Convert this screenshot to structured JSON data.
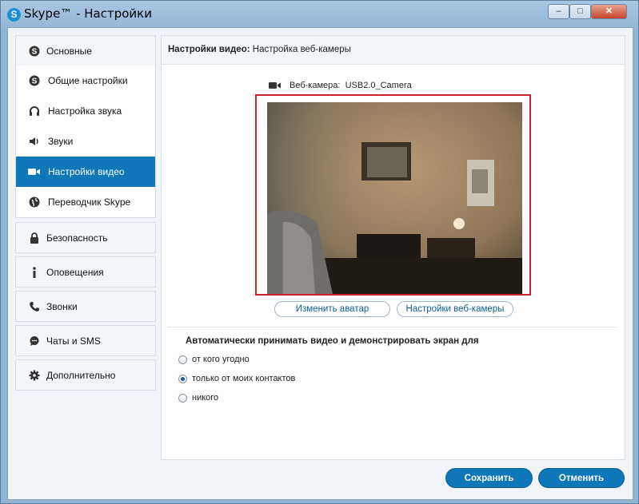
{
  "window": {
    "title": "Skype™ - Настройки",
    "title_icon": "skype-logo-icon",
    "controls": [
      "minimize-icon",
      "maximize-icon",
      "close-icon"
    ]
  },
  "sidebar": {
    "groups": [
      {
        "label": "Основные",
        "icon": "skype-icon",
        "items": [
          {
            "label": "Общие настройки",
            "icon": "skype-icon"
          },
          {
            "label": "Настройка звука",
            "icon": "headset-icon"
          },
          {
            "label": "Звуки",
            "icon": "speaker-icon"
          },
          {
            "label": "Настройки видео",
            "icon": "video-camera-icon",
            "active": true
          },
          {
            "label": "Переводчик Skype",
            "icon": "globe-icon"
          }
        ]
      },
      {
        "label": "Безопасность",
        "icon": "lock-icon"
      },
      {
        "label": "Оповещения",
        "icon": "info-icon"
      },
      {
        "label": "Звонки",
        "icon": "phone-icon"
      },
      {
        "label": "Чаты и SMS",
        "icon": "chat-icon"
      },
      {
        "label": "Дополнительно",
        "icon": "gear-icon"
      }
    ]
  },
  "main": {
    "header_bold": "Настройки видео:",
    "header_rest": " Настройка веб-камеры",
    "camera_label": "Веб-камера:",
    "camera_name": "USB2.0_Camera",
    "change_avatar": "Изменить аватар",
    "webcam_settings": "Настройки веб-камеры",
    "auto_accept_title": "Автоматически принимать видео и демонстрировать экран для",
    "radio_options": [
      {
        "label": "от кого угодно",
        "checked": false
      },
      {
        "label": "только от моих контактов",
        "checked": true
      },
      {
        "label": "никого",
        "checked": false
      }
    ]
  },
  "footer": {
    "save": "Сохранить",
    "cancel": "Отменить"
  },
  "colors": {
    "accent": "#0d77b8",
    "highlight_border": "#c8242b"
  }
}
